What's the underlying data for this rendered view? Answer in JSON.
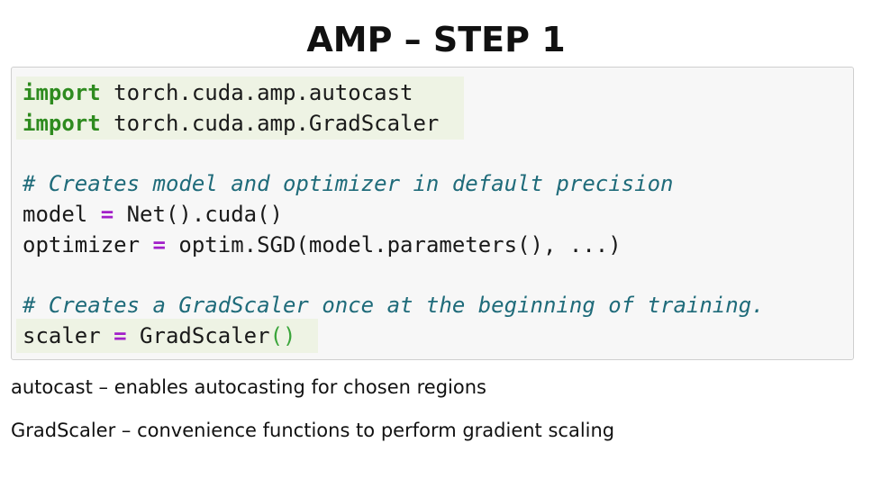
{
  "slide": {
    "title": "AMP – STEP 1"
  },
  "code": {
    "line1": {
      "kw": "import",
      "rest": " torch.cuda.amp.autocast"
    },
    "line2": {
      "kw": "import",
      "rest": " torch.cuda.amp.GradScaler"
    },
    "line3": {
      "comment": "# Creates model and optimizer in default precision"
    },
    "line4": {
      "lhs": "model ",
      "op": "=",
      "rhs": " Net().cuda()"
    },
    "line5": {
      "lhs": "optimizer ",
      "op": "=",
      "rhs": " optim.SGD(model.parameters(), ...)"
    },
    "line6": {
      "comment": "# Creates a GradScaler once at the beginning of training."
    },
    "line7": {
      "lhs": "scaler ",
      "op": "=",
      "rhs": " GradScaler",
      "paren": "()"
    }
  },
  "descriptions": {
    "autocast": "autocast – enables autocasting for chosen regions",
    "gradscaler": "GradScaler – convenience functions to perform gradient scaling"
  },
  "colors": {
    "keyword": "#2e8b1f",
    "operator": "#a21fc9",
    "comment": "#1f6b7a",
    "highlight": "#eef3e4",
    "code_background": "#f7f7f7"
  }
}
